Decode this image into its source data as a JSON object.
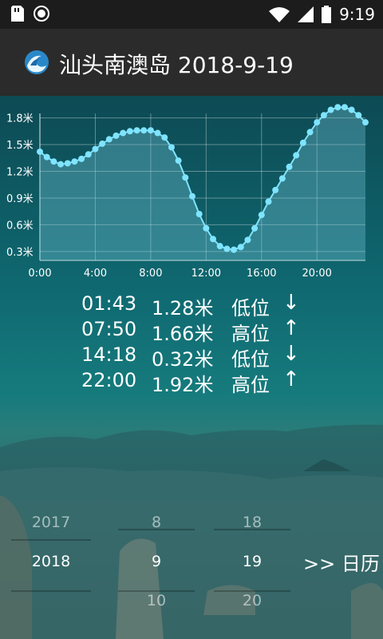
{
  "status_bar": {
    "time": "9:19",
    "icons": [
      "sd-card-icon",
      "record-icon",
      "wifi-icon",
      "signal-icon",
      "battery-icon"
    ]
  },
  "app": {
    "title": "汕头南澳岛 2018-9-19",
    "logo": "wave-icon"
  },
  "chart_data": {
    "type": "line",
    "xlabel": "",
    "ylabel": "",
    "x_tick_labels": [
      "0:00",
      "4:00",
      "8:00",
      "12:00",
      "16:00",
      "20:00"
    ],
    "y_tick_labels": [
      "0.3米",
      "0.6米",
      "0.9米",
      "1.2米",
      "1.5米",
      "1.8米"
    ],
    "ylim": [
      0.2,
      1.85
    ],
    "xlim": [
      0,
      23.5
    ],
    "grid": true,
    "colors": {
      "line": "#7fe4ff",
      "fill": "rgba(120,200,220,0.35)",
      "grid": "rgba(255,255,255,0.35)"
    },
    "series": [
      {
        "x": [
          0,
          0.5,
          1,
          1.5,
          2,
          2.5,
          3,
          3.5,
          4,
          4.5,
          5,
          5.5,
          6,
          6.5,
          7,
          7.5,
          8,
          8.5,
          9,
          9.5,
          10,
          10.5,
          11,
          11.5,
          12,
          12.5,
          13,
          13.5,
          14,
          14.5,
          15,
          15.5,
          16,
          16.5,
          17,
          17.5,
          18,
          18.5,
          19,
          19.5,
          20,
          20.5,
          21,
          21.5,
          22,
          22.5,
          23,
          23.5
        ],
        "values": [
          1.42,
          1.36,
          1.31,
          1.28,
          1.29,
          1.31,
          1.34,
          1.39,
          1.45,
          1.51,
          1.56,
          1.6,
          1.63,
          1.65,
          1.66,
          1.66,
          1.66,
          1.63,
          1.58,
          1.47,
          1.32,
          1.13,
          0.92,
          0.72,
          0.56,
          0.44,
          0.36,
          0.33,
          0.32,
          0.35,
          0.43,
          0.56,
          0.71,
          0.86,
          0.99,
          1.12,
          1.25,
          1.38,
          1.52,
          1.64,
          1.75,
          1.83,
          1.89,
          1.92,
          1.92,
          1.89,
          1.83,
          1.75
        ]
      }
    ]
  },
  "tide_events": [
    {
      "time": "01:43",
      "height": "1.28米",
      "type": "低位",
      "arrow": "↓"
    },
    {
      "time": "07:50",
      "height": "1.66米",
      "type": "高位",
      "arrow": "↑"
    },
    {
      "time": "14:18",
      "height": "0.32米",
      "type": "低位",
      "arrow": "↓"
    },
    {
      "time": "22:00",
      "height": "1.92米",
      "type": "高位",
      "arrow": "↑"
    }
  ],
  "date_picker": {
    "year": {
      "prev": "2017",
      "current": "2018"
    },
    "month": {
      "prev": "8",
      "current": "9",
      "next": "10"
    },
    "day": {
      "prev": "18",
      "current": "19",
      "next": "20"
    }
  },
  "calendar_button": ">> 日历"
}
